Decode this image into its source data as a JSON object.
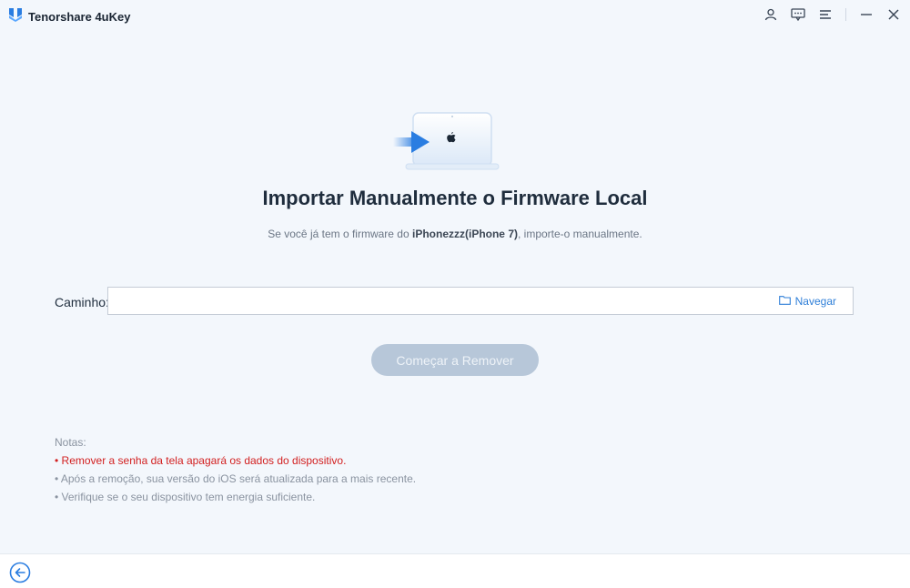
{
  "app": {
    "title": "Tenorshare 4uKey",
    "accent": "#2f7fd8",
    "warning_color": "#d21f1f"
  },
  "titlebar": {
    "icons": [
      "account-icon",
      "feedback-icon",
      "menu-icon",
      "minimize-icon",
      "close-icon"
    ]
  },
  "main": {
    "title": "Importar Manualmente o Firmware Local",
    "subtitle_prefix": "Se você já tem o firmware do ",
    "subtitle_device": "iPhonezzz(iPhone 7)",
    "subtitle_suffix": ", importe-o manualmente.",
    "path_label": "Caminho:",
    "path_value": "",
    "browse_label": "Navegar",
    "start_label": "Começar a Remover"
  },
  "notes": {
    "heading": "Notas:",
    "items": [
      "• Remover a senha da tela apagará os dados do dispositivo.",
      "• Após a remoção, sua versão do iOS será atualizada para a mais recente.",
      "• Verifique se o seu dispositivo tem energia suficiente."
    ]
  }
}
